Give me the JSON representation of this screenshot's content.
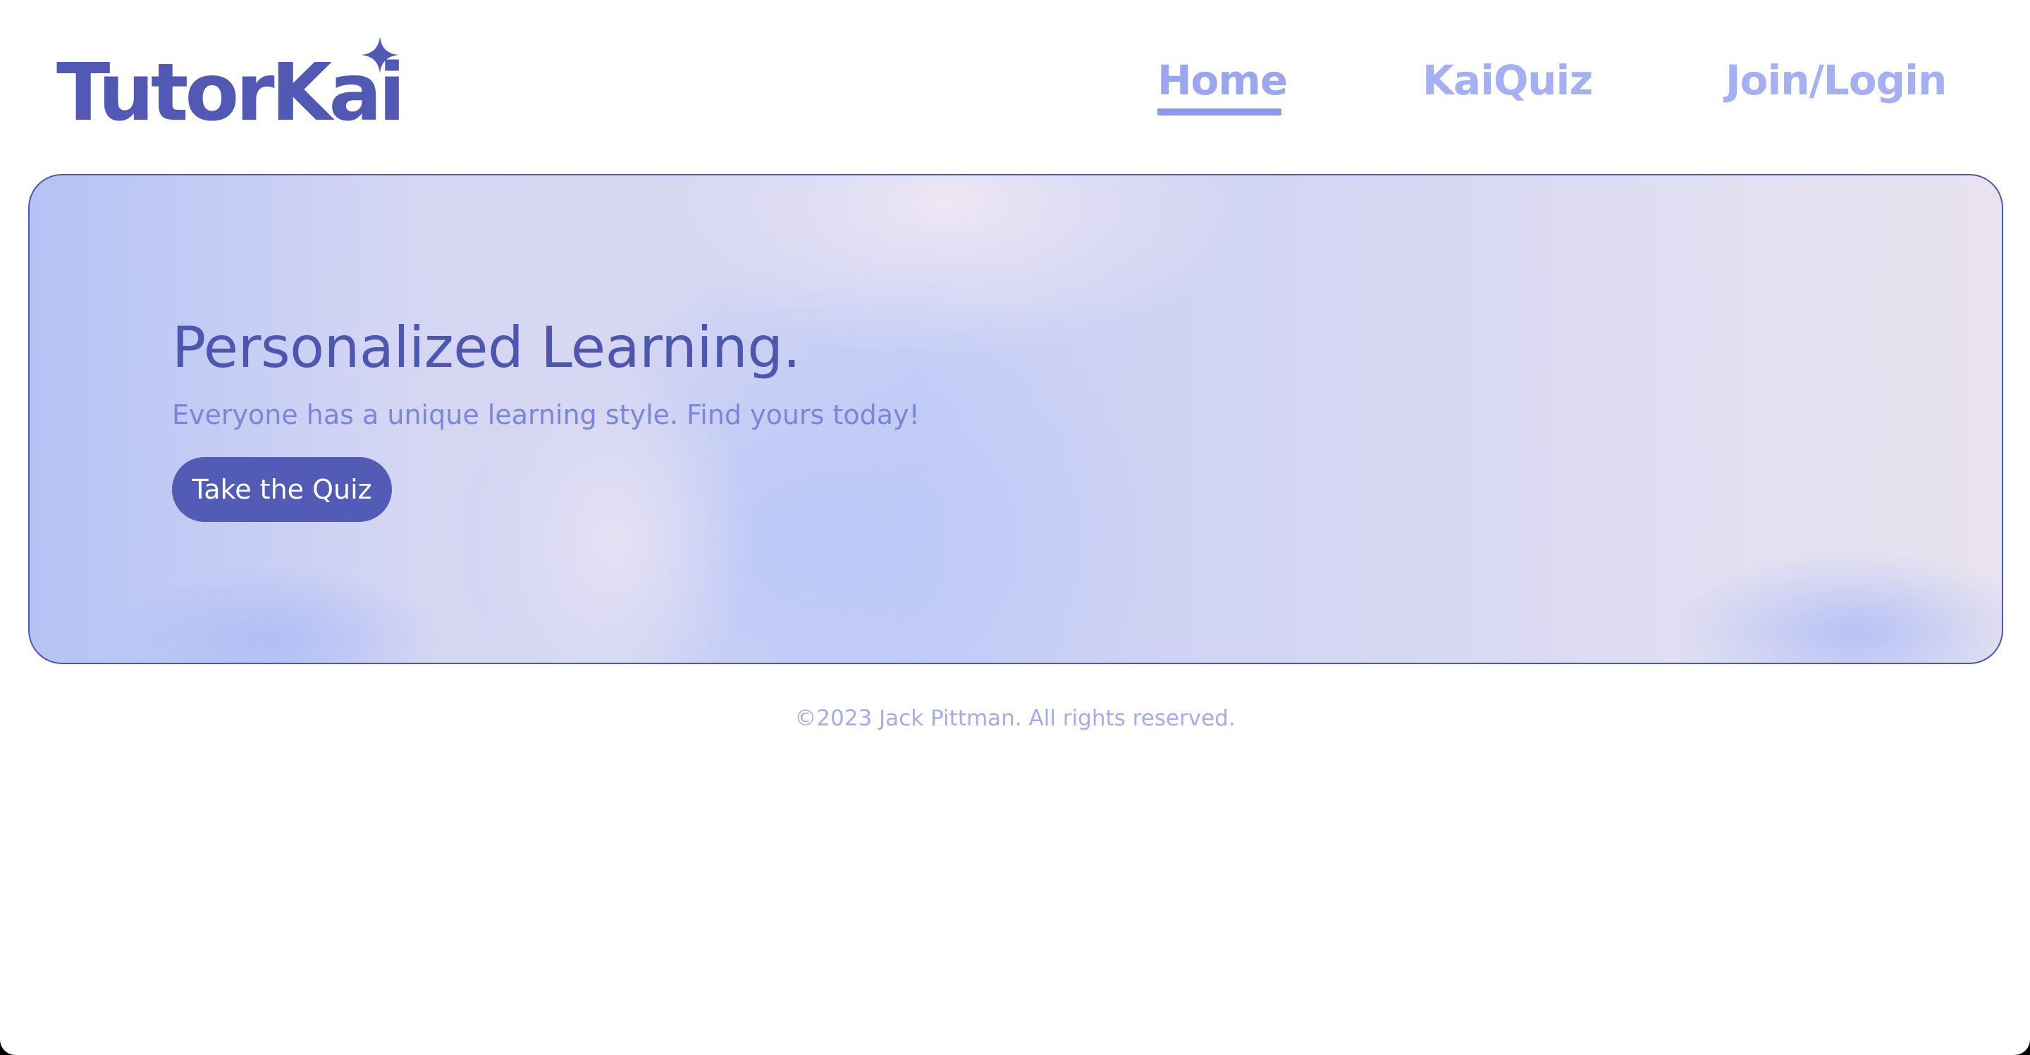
{
  "brand": {
    "name": "TutorKai",
    "color": "#5159b5"
  },
  "nav": {
    "items": [
      {
        "label": "Home",
        "active": true
      },
      {
        "label": "KaiQuiz",
        "active": false
      },
      {
        "label": "Join/Login",
        "active": false
      }
    ],
    "color": "#a4b0f3"
  },
  "hero": {
    "title": "Personalized Learning.",
    "subtitle": "Everyone has a unique learning style. Find yours today!",
    "cta_label": "Take the Quiz",
    "accent": "#525bb5"
  },
  "footer": {
    "copyright": "©2023 Jack Pittman. All rights reserved."
  },
  "icons": {
    "logo_star": "sparkle-icon"
  }
}
